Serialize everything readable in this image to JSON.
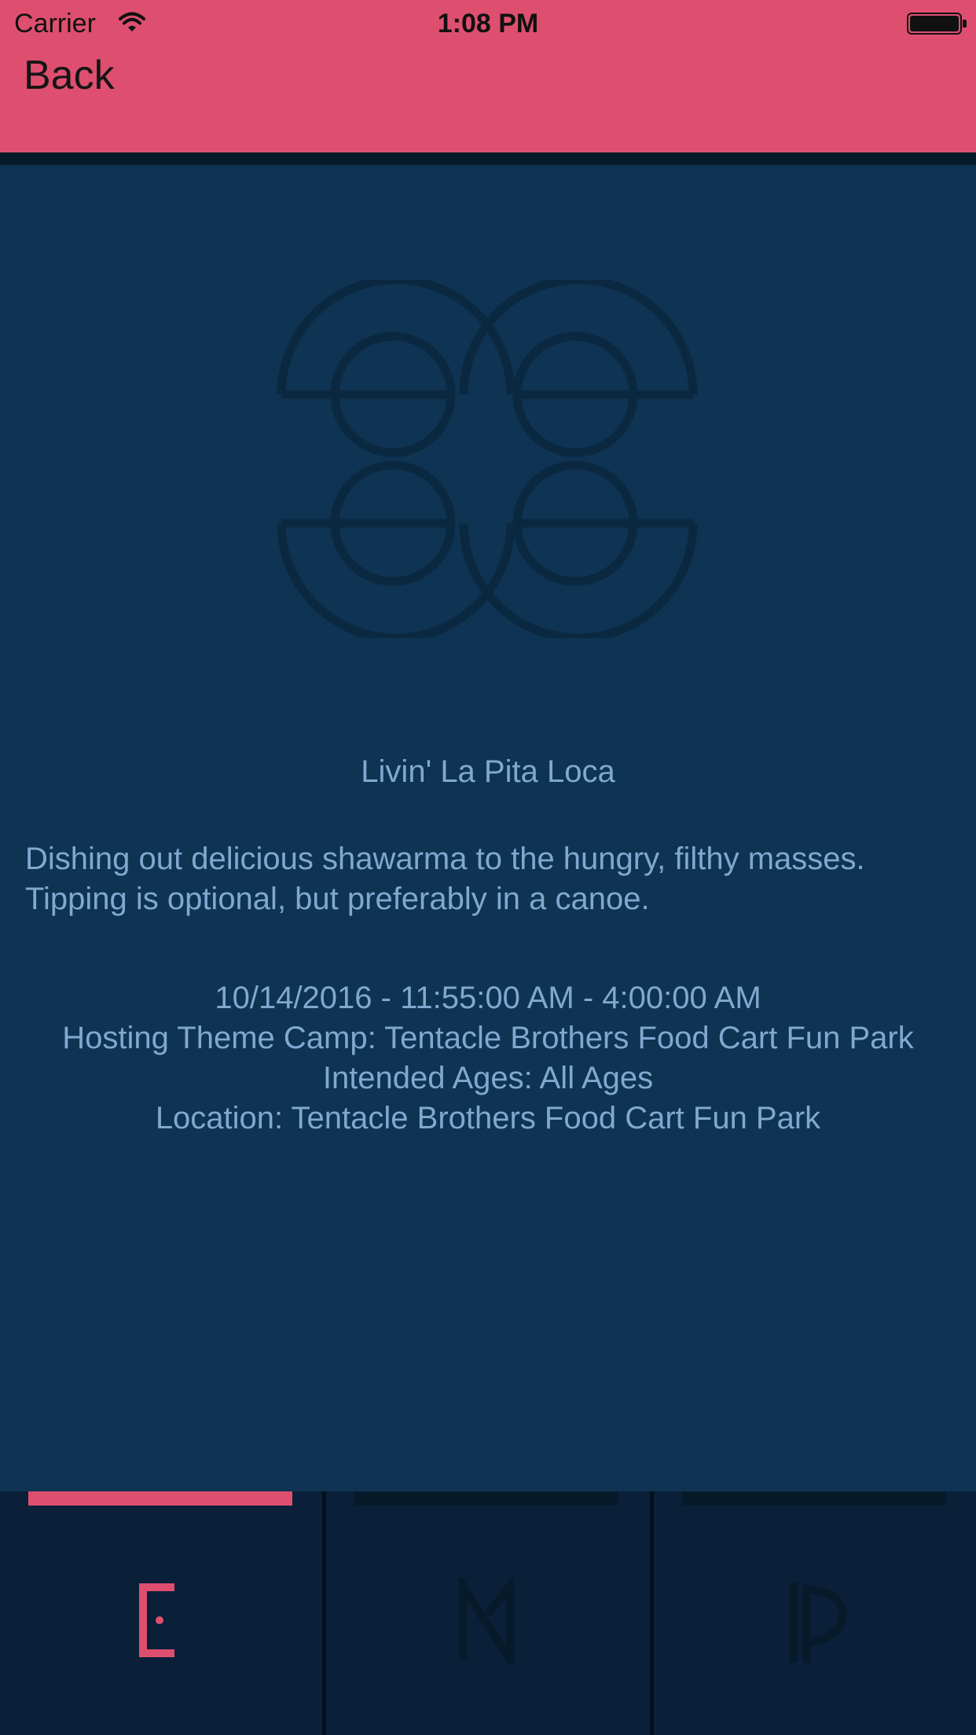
{
  "status_bar": {
    "carrier": "Carrier",
    "time": "1:08 PM"
  },
  "nav": {
    "back_label": "Back"
  },
  "event": {
    "title": "Livin' La Pita Loca",
    "description_line1": "Dishing out delicious shawarma to the hungry, filthy masses.",
    "description_line2": "Tipping is optional, but preferably in a canoe.",
    "datetime": "10/14/2016 - 11:55:00 AM - 4:00:00 AM",
    "hosting_camp": "Hosting Theme Camp: Tentacle Brothers Food Cart Fun Park",
    "ages": "Intended Ages: All Ages",
    "location": "Location: Tentacle Brothers Food Cart Fun Park"
  },
  "tabs": [
    {
      "icon": "events-rune-icon",
      "selected": true
    },
    {
      "icon": "map-rune-icon",
      "selected": false
    },
    {
      "icon": "people-rune-icon",
      "selected": false
    }
  ],
  "colors": {
    "accent": "#de4f6f",
    "background": "#0f3352",
    "text": "#7fa9cf",
    "tabbar": "#0a1f38",
    "inactive": "#061a2a"
  }
}
